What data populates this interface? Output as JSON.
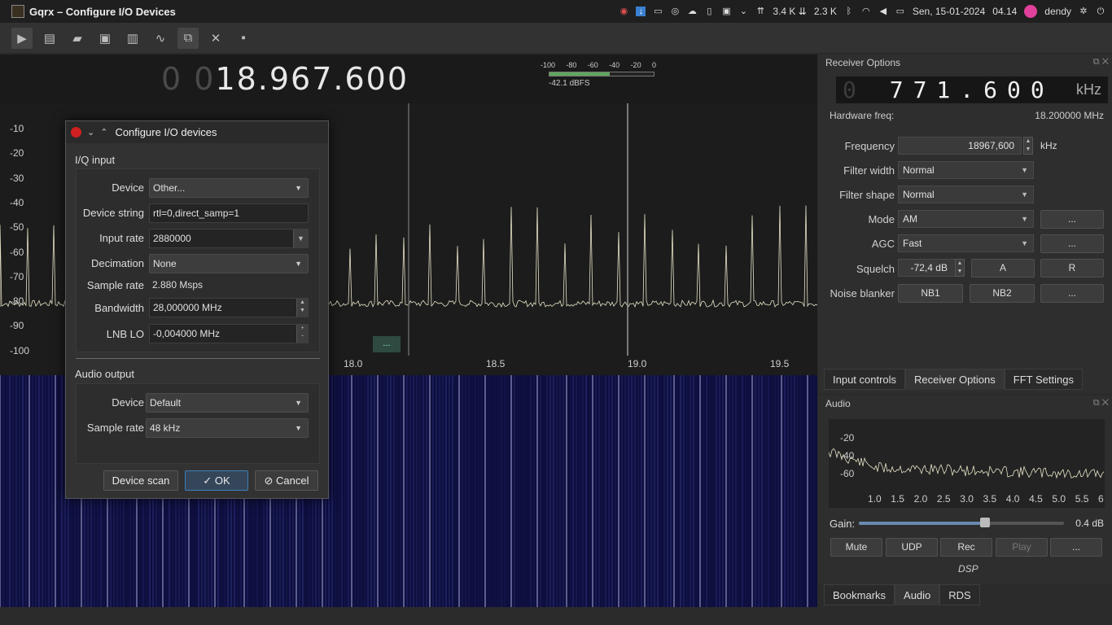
{
  "window": {
    "title": "Gqrx – Configure I/O Devices"
  },
  "tray": {
    "net_down": "3.4 K ⇊",
    "net_up": "2.3 K",
    "date": "Sen, 15-01-2024",
    "time": "04.14",
    "user": "dendy"
  },
  "toolbar": {
    "icons": [
      "play-icon",
      "hardware-icon",
      "open-icon",
      "save-icon",
      "bookmark-icon",
      "waveform-icon",
      "io-devices-icon",
      "tools-icon",
      "pin-icon"
    ]
  },
  "main": {
    "freq_dim": "0 0",
    "freq_value": "18.967.600",
    "smeter_scale": [
      "-100",
      "-80",
      "-60",
      "-40",
      "-20",
      "0"
    ],
    "smeter_readout": "-42.1 dBFS",
    "smeter_level": 0.58,
    "y_ticks": [
      "-10",
      "-20",
      "-30",
      "-40",
      "-50",
      "-60",
      "-70",
      "-80",
      "-90",
      "-100"
    ],
    "x_ticks": [
      "18.0",
      "18.5",
      "19.0",
      "19.5"
    ],
    "filter_handle": "..."
  },
  "receiver": {
    "title": "Receiver Options",
    "lcd_dim": "0",
    "lcd_digits": "771.600",
    "lcd_unit": "kHz",
    "hw_freq_label": "Hardware freq:",
    "hw_freq_value": "18.200000 MHz",
    "frequency_label": "Frequency",
    "frequency_value": "18967,600",
    "frequency_unit": "kHz",
    "filter_width_label": "Filter width",
    "filter_width_value": "Normal",
    "filter_shape_label": "Filter shape",
    "filter_shape_value": "Normal",
    "mode_label": "Mode",
    "mode_value": "AM",
    "mode_more": "...",
    "agc_label": "AGC",
    "agc_value": "Fast",
    "agc_more": "...",
    "squelch_label": "Squelch",
    "squelch_value": "-72,4 dB",
    "squelch_a": "A",
    "squelch_r": "R",
    "nb_label": "Noise blanker",
    "nb1": "NB1",
    "nb2": "NB2",
    "nb_more": "...",
    "tabs": [
      "Input controls",
      "Receiver Options",
      "FFT Settings"
    ]
  },
  "audio": {
    "title": "Audio",
    "y_ticks": [
      "-20",
      "-40",
      "-60"
    ],
    "x_ticks": [
      "1.0",
      "1.5",
      "2.0",
      "2.5",
      "3.0",
      "3.5",
      "4.0",
      "4.5",
      "5.0",
      "5.5",
      "6"
    ],
    "gain_label": "Gain:",
    "gain_value": "0.4 dB",
    "gain_level": 0.6,
    "buttons": [
      "Mute",
      "UDP",
      "Rec",
      "Play",
      "..."
    ],
    "dsp_label": "DSP",
    "tabs": [
      "Bookmarks",
      "Audio",
      "RDS"
    ]
  },
  "dialog": {
    "title": "Configure I/O devices",
    "iq_group": "I/Q input",
    "device_label": "Device",
    "device_value": "Other...",
    "device_string_label": "Device string",
    "device_string_value": "rtl=0,direct_samp=1",
    "input_rate_label": "Input rate",
    "input_rate_value": "2880000",
    "decimation_label": "Decimation",
    "decimation_value": "None",
    "sample_rate_label": "Sample rate",
    "sample_rate_value": "2.880 Msps",
    "bandwidth_label": "Bandwidth",
    "bandwidth_value": "28,000000 MHz",
    "lnb_label": "LNB LO",
    "lnb_value": "-0,004000 MHz",
    "audio_group": "Audio output",
    "audio_device_label": "Device",
    "audio_device_value": "Default",
    "audio_rate_label": "Sample rate",
    "audio_rate_value": "48 kHz",
    "btn_scan": "Device scan",
    "btn_ok": "OK",
    "btn_cancel": "Cancel"
  }
}
